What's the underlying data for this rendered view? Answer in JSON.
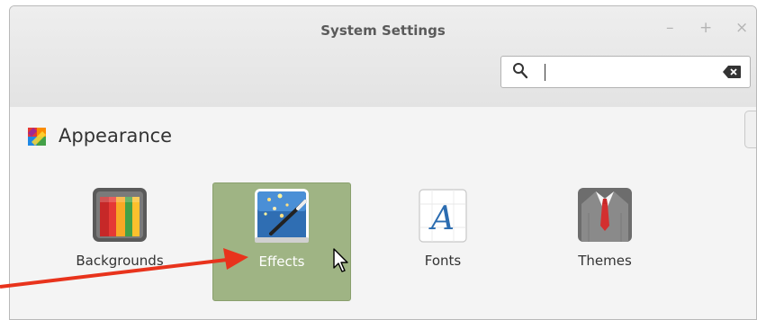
{
  "window": {
    "title": "System Settings",
    "controls": {
      "minimize": "–",
      "maximize": "+",
      "close": "×"
    }
  },
  "search": {
    "value": "",
    "placeholder": "",
    "icon": "search-icon",
    "clear_icon": "backspace-icon"
  },
  "section": {
    "title": "Appearance",
    "icon": "appearance-icon",
    "items": [
      {
        "label": "Backgrounds",
        "icon": "backgrounds-icon",
        "selected": false
      },
      {
        "label": "Effects",
        "icon": "effects-icon",
        "selected": true
      },
      {
        "label": "Fonts",
        "icon": "fonts-icon",
        "selected": false
      },
      {
        "label": "Themes",
        "icon": "themes-icon",
        "selected": false
      }
    ]
  },
  "colors": {
    "selection": "#9fb484",
    "annotation_arrow": "#e8331c"
  }
}
